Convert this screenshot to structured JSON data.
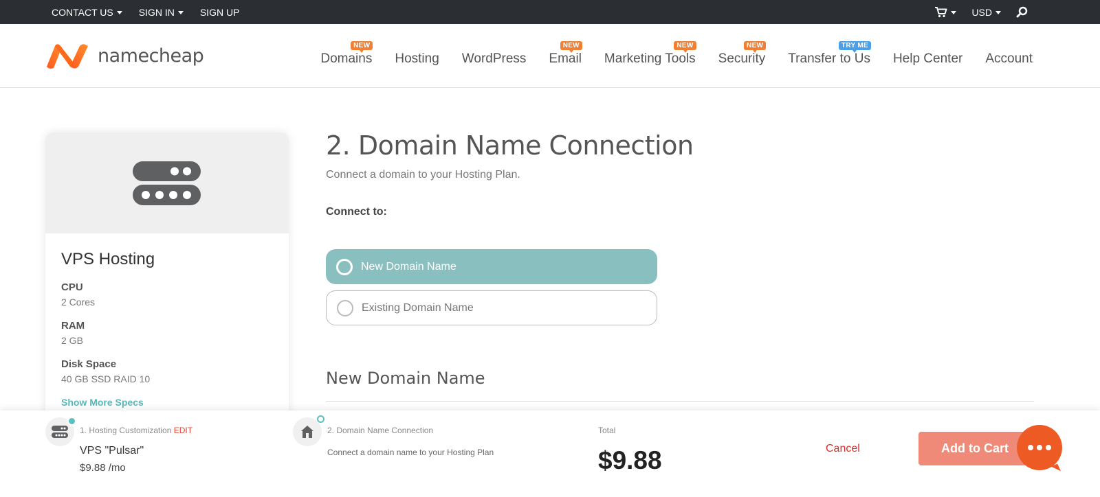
{
  "topbar": {
    "contact": "CONTACT US",
    "signin": "SIGN IN",
    "signup": "SIGN UP",
    "currency": "USD"
  },
  "header": {
    "logo_text": "namecheap",
    "nav": [
      {
        "label": "Domains",
        "badge": "NEW"
      },
      {
        "label": "Hosting",
        "badge": ""
      },
      {
        "label": "WordPress",
        "badge": ""
      },
      {
        "label": "Email",
        "badge": "NEW"
      },
      {
        "label": "Marketing Tools",
        "badge": "NEW"
      },
      {
        "label": "Security",
        "badge": "NEW"
      },
      {
        "label": "Transfer to Us",
        "badge": "TRY ME"
      },
      {
        "label": "Help Center",
        "badge": ""
      },
      {
        "label": "Account",
        "badge": ""
      }
    ]
  },
  "card": {
    "title": "VPS Hosting",
    "specs": [
      {
        "label": "CPU",
        "value": "2 Cores"
      },
      {
        "label": "RAM",
        "value": "2 GB"
      },
      {
        "label": "Disk Space",
        "value": "40 GB SSD RAID 10"
      }
    ],
    "show_more": "Show More Specs"
  },
  "main": {
    "title": "2. Domain Name Connection",
    "subtitle": "Connect a domain to your Hosting Plan.",
    "connect_label": "Connect to:",
    "option_new": "New Domain Name",
    "option_existing": "Existing Domain Name",
    "section_title": "New Domain Name"
  },
  "bottom": {
    "step1_label": "1. Hosting Customization",
    "step1_edit": "EDIT",
    "plan_name": "VPS \"Pulsar\"",
    "plan_price": "$9.88 /mo",
    "step2_label": "2. Domain Name Connection",
    "step2_desc": "Connect a domain name to your Hosting Plan",
    "total_label": "Total",
    "total_value": "$9.88",
    "cancel": "Cancel",
    "add_to_cart": "Add to Cart"
  },
  "colors": {
    "topbar_bg": "#2b2e33",
    "selected_option": "#89c0bf",
    "badge_orange": "#f08035",
    "badge_blue": "#4b9fe6",
    "add_cart": "#f08a78",
    "chat": "#ee5a24"
  }
}
